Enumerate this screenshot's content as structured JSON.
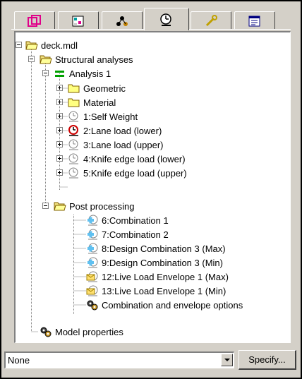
{
  "tabs": [
    {
      "icon": "geometry-view-icon"
    },
    {
      "icon": "grid-view-icon"
    },
    {
      "icon": "group-icon"
    },
    {
      "icon": "analysis-clock-icon",
      "active": true
    },
    {
      "icon": "wrench-icon"
    },
    {
      "icon": "properties-icon"
    }
  ],
  "tree": {
    "root": {
      "label": "deck.mdl",
      "expanded": true,
      "icon": "open-folder-icon"
    },
    "structural_analyses": {
      "label": "Structural analyses",
      "expanded": true,
      "icon": "open-folder-icon"
    },
    "analysis": {
      "label": "Analysis 1",
      "expanded": true,
      "icon": "analysis-equals-icon",
      "icon_color": "#00a000"
    },
    "analysis_children": [
      {
        "label": "Geometric",
        "icon": "folder-icon"
      },
      {
        "label": "Material",
        "icon": "folder-icon"
      },
      {
        "label": "1:Self Weight",
        "icon": "clock-icon"
      },
      {
        "label": "2:Lane load (lower)",
        "icon": "clock-active-icon",
        "accent": "#cc0000"
      },
      {
        "label": "3:Lane load (upper)",
        "icon": "clock-icon"
      },
      {
        "label": "4:Knife edge load (lower)",
        "icon": "clock-icon"
      },
      {
        "label": "5:Knife edge load (upper)",
        "icon": "clock-icon"
      }
    ],
    "post_processing": {
      "label": "Post processing",
      "expanded": true,
      "icon": "open-folder-icon"
    },
    "post_children": [
      {
        "label": "6:Combination 1",
        "icon": "combination-icon"
      },
      {
        "label": "7:Combination 2",
        "icon": "combination-icon"
      },
      {
        "label": "8:Design Combination 3 (Max)",
        "icon": "combination-icon"
      },
      {
        "label": "9:Design Combination 3 (Min)",
        "icon": "combination-icon"
      },
      {
        "label": "12:Live Load Envelope 1 (Max)",
        "icon": "envelope-icon"
      },
      {
        "label": "13:Live Load Envelope 1 (Min)",
        "icon": "envelope-icon"
      },
      {
        "label": "Combination and envelope options",
        "icon": "gears-icon"
      }
    ],
    "model_properties": {
      "label": "Model properties",
      "icon": "gears-icon"
    }
  },
  "footer": {
    "combo_value": "None",
    "specify_label": "Specify..."
  }
}
